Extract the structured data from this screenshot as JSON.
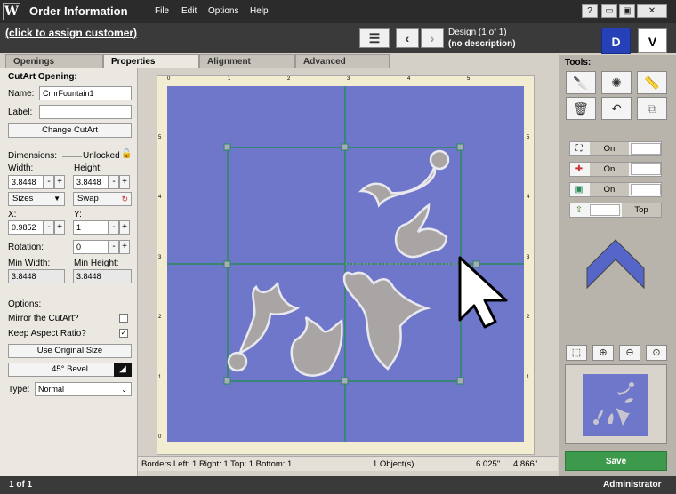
{
  "app": {
    "title": "Order Information",
    "logo": "W"
  },
  "menu": [
    "File",
    "Edit",
    "Options",
    "Help"
  ],
  "window_buttons": [
    "?",
    "▭",
    "▣",
    "✕"
  ],
  "header": {
    "assign_customer": "(click to assign customer)",
    "design_count": "Design  (1 of 1)",
    "design_desc": "(no description)",
    "d_button": "D",
    "v_button": "V"
  },
  "tabs": [
    "Openings",
    "Properties",
    "Alignment",
    "Advanced"
  ],
  "properties": {
    "section_title": "CutArt Opening:",
    "name_label": "Name:",
    "name_value": "CrnrFountain1",
    "label_label": "Label:",
    "label_value": "",
    "change_cutart": "Change CutArt",
    "dimensions_label": "Dimensions:",
    "unlocked_label": "Unlocked",
    "width_label": "Width:",
    "width_value": "3.8448",
    "height_label": "Height:",
    "height_value": "3.8448",
    "sizes_label": "Sizes",
    "swap_label": "Swap",
    "x_label": "X:",
    "x_value": "0.9852",
    "y_label": "Y:",
    "y_value": "1",
    "rotation_label": "Rotation:",
    "rotation_value": "0",
    "min_width_label": "Min Width:",
    "min_width_value": "3.8448",
    "min_height_label": "Min Height:",
    "min_height_value": "3.8448",
    "options_label": "Options:",
    "mirror_label": "Mirror the CutArt?",
    "mirror_checked": false,
    "aspect_label": "Keep Aspect Ratio?",
    "aspect_checked": true,
    "use_original": "Use Original Size",
    "bevel_label": "45° Bevel",
    "type_label": "Type:",
    "type_value": "Normal"
  },
  "ruler": {
    "top": [
      "0",
      "1",
      "2",
      "3",
      "4",
      "5"
    ],
    "left": [
      "5",
      "4",
      "3",
      "2",
      "1",
      "0"
    ],
    "right": [
      "5",
      "4",
      "3",
      "2",
      "1"
    ]
  },
  "status": {
    "borders": "Borders  Left: 1  Right: 1  Top: 1  Bottom: 1",
    "objects": "1 Object(s)",
    "coord_x": "6.025\"",
    "coord_y": "4.866\""
  },
  "tools": {
    "label": "Tools:",
    "toggles": [
      {
        "icon": "corner-handles-icon",
        "label": "On"
      },
      {
        "icon": "crosshair-icon",
        "label": "On"
      },
      {
        "icon": "frame-icon",
        "label": "On"
      },
      {
        "icon": "arrow-up-icon",
        "label": "Top"
      }
    ]
  },
  "save_label": "Save",
  "footer": {
    "page": "1 of 1",
    "user": "Administrator"
  },
  "colors": {
    "mat": "#6e77c9",
    "accent": "#2640b8",
    "save": "#3d9a4d",
    "grid": "#2a8a5a"
  }
}
